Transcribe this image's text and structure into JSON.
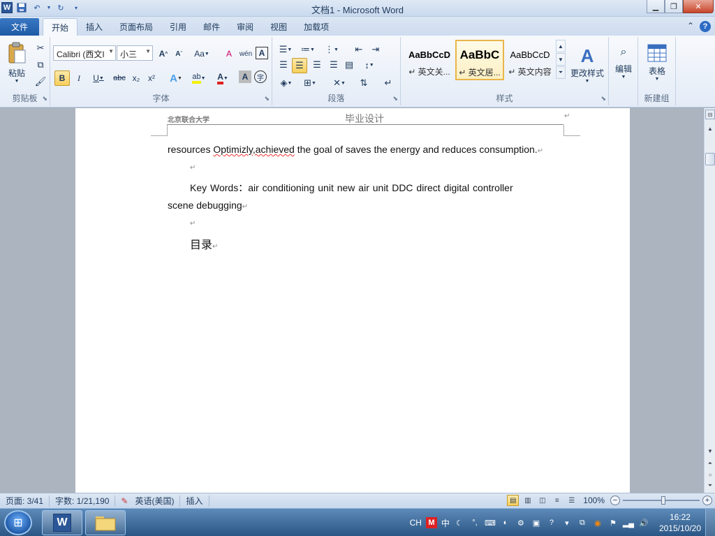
{
  "window": {
    "title": "文档1 - Microsoft Word",
    "app_icon": "W"
  },
  "qat": {
    "save_icon": "save-icon",
    "undo_icon": "undo-icon",
    "redo_icon": "redo-icon"
  },
  "tabs": {
    "file": "文件",
    "items": [
      "开始",
      "插入",
      "页面布局",
      "引用",
      "邮件",
      "审阅",
      "视图",
      "加载项"
    ],
    "active": "开始"
  },
  "ribbon": {
    "clipboard": {
      "label": "剪贴板",
      "paste": "粘贴"
    },
    "font": {
      "label": "字体",
      "family": "Calibri (西文I",
      "size": "小三",
      "bold": "B",
      "italic": "I",
      "underline": "U",
      "strike": "abc",
      "subscript": "x₂",
      "superscript": "x²",
      "grow": "A",
      "shrink": "A",
      "case": "Aa",
      "clear_format": "A",
      "phonetic": "wén",
      "border_char": "A",
      "text_effect": "A",
      "highlight": "ab",
      "font_color": "A",
      "char_shading": "A",
      "enclose": "字"
    },
    "paragraph": {
      "label": "段落"
    },
    "styles": {
      "label": "样式",
      "items": [
        {
          "sample": "AaBbCcD",
          "name": "↵ 英文关..."
        },
        {
          "sample": "AaBbC",
          "name": "↵ 英文居..."
        },
        {
          "sample": "AaBbCcD",
          "name": "↵ 英文内容"
        }
      ],
      "change_styles": "更改样式"
    },
    "editing": {
      "label": "编辑"
    },
    "newgroup": {
      "label": "新建组",
      "table": "表格"
    }
  },
  "document": {
    "header_school": "北京联合大学",
    "header_title": "毕业设计",
    "line1_a": "resources ",
    "line1_sq": "Optimizly,achieved",
    "line1_b": " the goal of saves the energy and reduces consumption.",
    "keywords_line1": "Key Words：air conditioning unit    new air unit    DDC      direct digital controller",
    "keywords_line2": "scene debugging",
    "toc_heading": "目录",
    "para_mark": "↵"
  },
  "status": {
    "page": "页面: 3/41",
    "words": "字数: 1/21,190",
    "language": "英语(美国)",
    "mode": "插入",
    "zoom": "100%",
    "zoom_level": 1.0
  },
  "taskbar": {
    "lang": "CH",
    "ime": "中",
    "date": "2015/10/20",
    "time": "16:22"
  },
  "colors": {
    "file_tab": "#2b5fae",
    "highlight_yellow": "#f7cf5c",
    "font_color_red": "#e02020"
  }
}
